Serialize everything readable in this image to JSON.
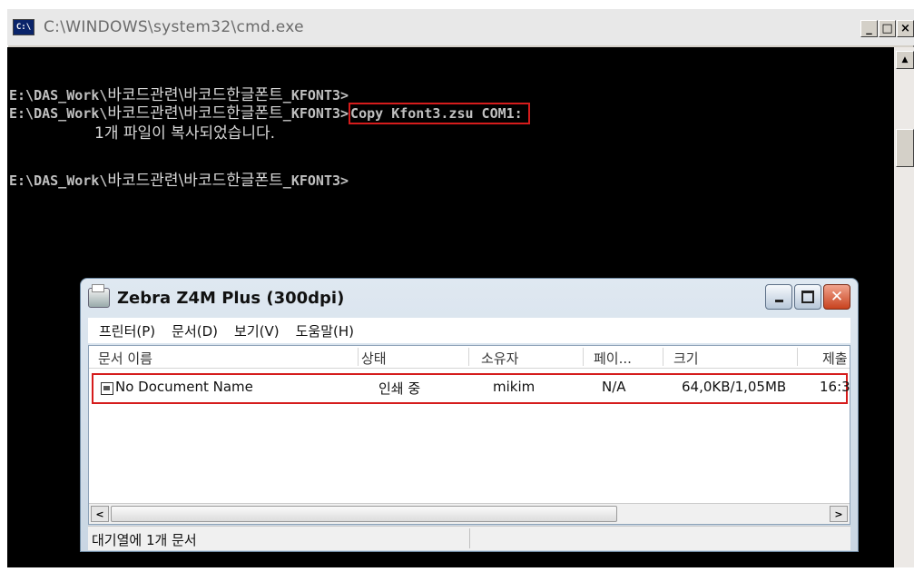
{
  "cmd": {
    "title": "C:\\WINDOWS\\system32\\cmd.exe",
    "icon": "cmd-app-icon",
    "buttons": {
      "minimize": "_",
      "maximize": "□",
      "close": "×"
    },
    "lines": [
      {
        "prefix": "E:\\DAS_Work\\",
        "ko": "바코드관련\\바코드한글폰트",
        "suffix": "_KFONT3>",
        "command": ""
      },
      {
        "prefix": "E:\\DAS_Work\\",
        "ko": "바코드관련\\바코드한글폰트",
        "suffix": "_KFONT3>",
        "command": "Copy Kfont3.zsu COM1:"
      },
      {
        "output": "1개 파일이 복사되었습니다."
      },
      {
        "prefix": "E:\\DAS_Work\\",
        "ko": "바코드관련\\바코드한글폰트",
        "suffix": "_KFONT3>",
        "command": ""
      }
    ]
  },
  "queue": {
    "title": "Zebra  Z4M Plus (300dpi)",
    "menu": [
      "프린터(P)",
      "문서(D)",
      "보기(V)",
      "도움말(H)"
    ],
    "columns": [
      "문서 이름",
      "상태",
      "소유자",
      "페이...",
      "크기",
      "제출"
    ],
    "row": {
      "name": "No Document Name",
      "status": "인쇄 중",
      "owner": "mikim",
      "pages": "N/A",
      "size": "64,0KB/1,05MB",
      "submitted": "16:3"
    },
    "status_bar": "대기열에 1개 문서"
  }
}
